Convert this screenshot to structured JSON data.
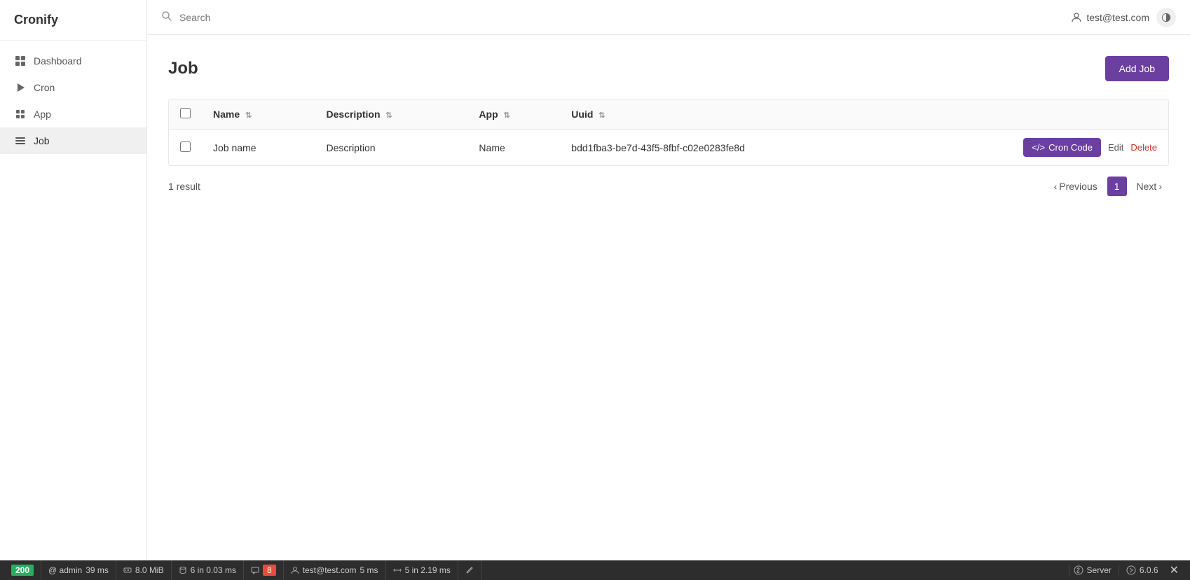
{
  "sidebar": {
    "logo": "Cronify",
    "nav": [
      {
        "id": "dashboard",
        "label": "Dashboard",
        "icon": "dashboard-icon",
        "active": false
      },
      {
        "id": "cron",
        "label": "Cron",
        "icon": "cron-icon",
        "active": false
      },
      {
        "id": "app",
        "label": "App",
        "icon": "app-icon",
        "active": false
      },
      {
        "id": "job",
        "label": "Job",
        "icon": "job-icon",
        "active": true
      }
    ]
  },
  "topbar": {
    "search_placeholder": "Search",
    "user_email": "test@test.com"
  },
  "main": {
    "page_title": "Job",
    "add_button_label": "Add Job",
    "table": {
      "columns": [
        "Name",
        "Description",
        "App",
        "Uuid"
      ],
      "rows": [
        {
          "name": "Job name",
          "description": "Description",
          "app": "Name",
          "uuid": "bdd1fba3-be7d-43f5-8fbf-c02e0283fe8d"
        }
      ]
    },
    "result_count": "1 result",
    "cron_code_label": "Cron Code",
    "edit_label": "Edit",
    "delete_label": "Delete",
    "pagination": {
      "previous_label": "Previous",
      "next_label": "Next",
      "current_page": "1"
    }
  },
  "statusbar": {
    "http_code": "200",
    "admin": "@ admin",
    "time_ms": "39 ms",
    "memory": "8.0 MiB",
    "db_queries": "6 in 0.03 ms",
    "messages_count": "8",
    "user": "test@test.com",
    "user_time": "5 ms",
    "server_queries": "5 in 2.19 ms",
    "server_label": "Server",
    "version": "6.0.6"
  }
}
